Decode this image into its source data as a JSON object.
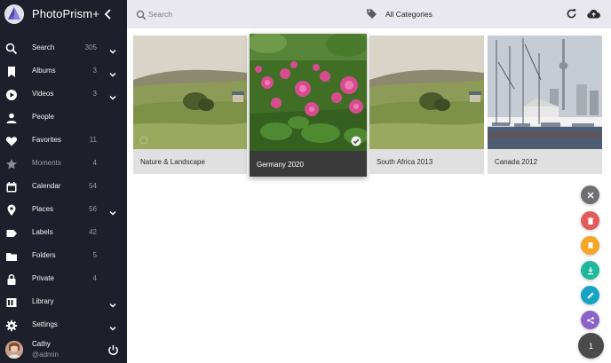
{
  "app": {
    "title": "PhotoPrism+"
  },
  "sidebar": {
    "items": [
      {
        "label": "Search",
        "count": "305",
        "icon": "search-icon",
        "chevron": true
      },
      {
        "label": "Albums",
        "count": "3",
        "icon": "bookmark-icon",
        "chevron": true
      },
      {
        "label": "Videos",
        "count": "3",
        "icon": "play-circle-icon",
        "chevron": true
      },
      {
        "label": "People",
        "count": "",
        "icon": "person-icon",
        "chevron": false
      },
      {
        "label": "Favorites",
        "count": "11",
        "icon": "heart-icon",
        "chevron": false
      },
      {
        "label": "Moments",
        "count": "4",
        "icon": "star-icon",
        "chevron": false
      },
      {
        "label": "Calendar",
        "count": "54",
        "icon": "calendar-icon",
        "chevron": false
      },
      {
        "label": "Places",
        "count": "56",
        "icon": "map-pin-icon",
        "chevron": true
      },
      {
        "label": "Labels",
        "count": "42",
        "icon": "label-icon",
        "chevron": false
      },
      {
        "label": "Folders",
        "count": "5",
        "icon": "folder-icon",
        "chevron": false
      },
      {
        "label": "Private",
        "count": "4",
        "icon": "lock-icon",
        "chevron": false
      },
      {
        "label": "Library",
        "count": "",
        "icon": "library-icon",
        "chevron": true
      },
      {
        "label": "Settings",
        "count": "",
        "icon": "gear-icon",
        "chevron": true
      }
    ],
    "user": {
      "name": "Cathy",
      "handle": "@admin"
    }
  },
  "toolbar": {
    "search_placeholder": "Search",
    "category": "All Categories"
  },
  "albums": [
    {
      "title": "Nature & Landscape",
      "selected": false
    },
    {
      "title": "Germany 2020",
      "selected": true
    },
    {
      "title": "South Africa 2013",
      "selected": false
    },
    {
      "title": "Canada 2012",
      "selected": false
    }
  ],
  "actions": {
    "selected_count": "1",
    "colors": {
      "close": "#6e6e73",
      "delete": "#e25c5c",
      "bookmark": "#f5a623",
      "download": "#1fb89a",
      "edit": "#16a3c4",
      "share": "#8d63c8",
      "count": "#4a4a4a"
    }
  },
  "colors": {
    "sidebar": "#1d1f2b",
    "topbar": "#e8e8ee"
  }
}
